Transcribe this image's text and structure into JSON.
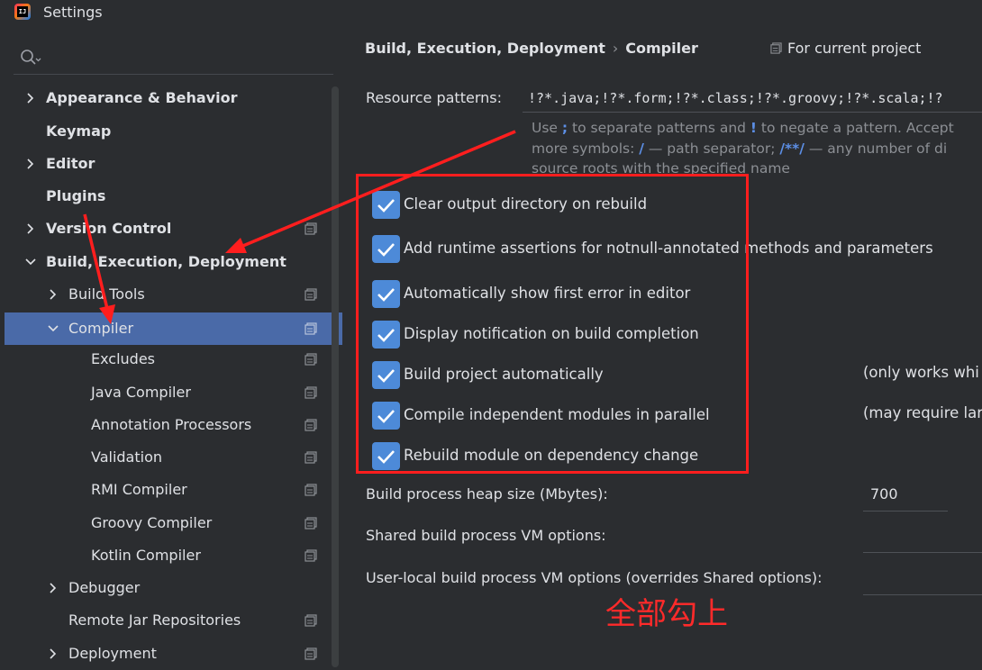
{
  "window": {
    "title": "Settings"
  },
  "search": {
    "placeholder": ""
  },
  "tree": {
    "items": [
      {
        "label": "Appearance & Behavior"
      },
      {
        "label": "Keymap"
      },
      {
        "label": "Editor"
      },
      {
        "label": "Plugins"
      },
      {
        "label": "Version Control"
      },
      {
        "label": "Build, Execution, Deployment"
      },
      {
        "label": "Build Tools"
      },
      {
        "label": "Compiler"
      },
      {
        "label": "Excludes"
      },
      {
        "label": "Java Compiler"
      },
      {
        "label": "Annotation Processors"
      },
      {
        "label": "Validation"
      },
      {
        "label": "RMI Compiler"
      },
      {
        "label": "Groovy Compiler"
      },
      {
        "label": "Kotlin Compiler"
      },
      {
        "label": "Debugger"
      },
      {
        "label": "Remote Jar Repositories"
      },
      {
        "label": "Deployment"
      }
    ]
  },
  "header": {
    "crumb1": "Build, Execution, Deployment",
    "separator": "›",
    "crumb2": "Compiler",
    "scope": "For current project"
  },
  "resource": {
    "label": "Resource patterns:",
    "value": "!?*.java;!?*.form;!?*.class;!?*.groovy;!?*.scala;!?",
    "hint": {
      "line1_a": "Use ",
      "line1_sym1": ";",
      "line1_b": " to separate patterns and ",
      "line1_sym2": "!",
      "line1_c": " to negate a pattern. Accept",
      "line2_a": "more symbols: ",
      "line2_sym1": "/",
      "line2_b": " — path separator; ",
      "line2_sym2": "/**/",
      "line2_c": " — any number of di",
      "line3": "source roots with the specified name"
    }
  },
  "options": [
    {
      "label": "Clear output directory on rebuild",
      "checked": true
    },
    {
      "label": "Add runtime assertions for notnull-annotated methods and parameters",
      "checked": true
    },
    {
      "label": "Automatically show first error in editor",
      "checked": true
    },
    {
      "label": "Display notification on build completion",
      "checked": true
    },
    {
      "label": "Build project automatically",
      "checked": true,
      "note": "(only works whi"
    },
    {
      "label": "Compile independent modules in parallel",
      "checked": true,
      "note": "(may require lar"
    },
    {
      "label": "Rebuild module on dependency change",
      "checked": true
    }
  ],
  "fields": {
    "heap_label": "Build process heap size (Mbytes):",
    "heap_value": "700",
    "shared_label": "Shared build process VM options:",
    "local_label": "User-local build process VM options (overrides Shared options):"
  },
  "annotation": {
    "text": "全部勾上"
  },
  "colors": {
    "accent": "#4d8ad8",
    "selection": "#4a6aa8",
    "annotation": "#ff1e1e",
    "background": "#2b2d30"
  }
}
